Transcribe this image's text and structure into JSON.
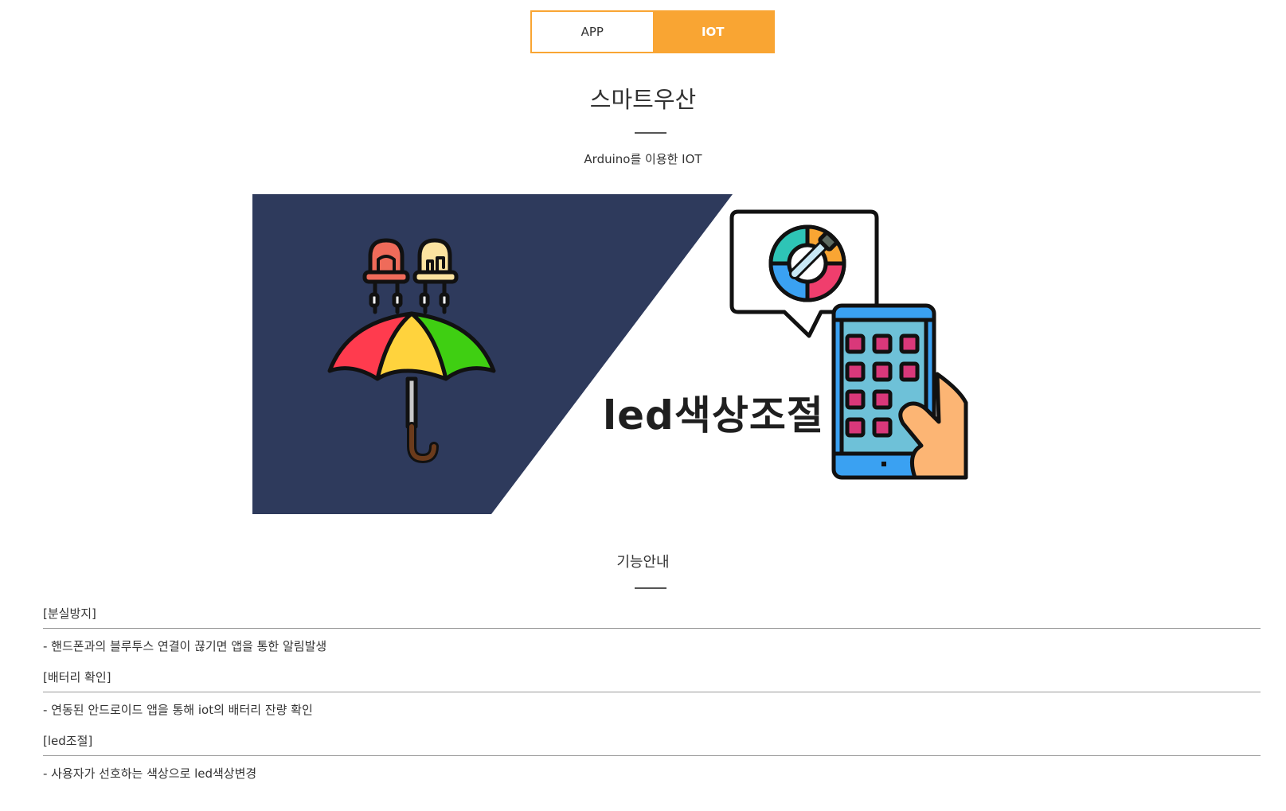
{
  "tabs": [
    {
      "label": "APP",
      "active": false
    },
    {
      "label": "IOT",
      "active": true
    }
  ],
  "colors": {
    "accent": "#f9a533",
    "hero_dark": "#2e3a5c"
  },
  "header": {
    "title": "스마트우산",
    "subtitle": "Arduino를 이용한 IOT"
  },
  "hero": {
    "caption": "led색상조절"
  },
  "section": {
    "title": "기능안내"
  },
  "features": [
    {
      "heading": "[분실방지]",
      "description": "- 핸드폰과의 블루투스 연결이 끊기면 앱을 통한 알림발생"
    },
    {
      "heading": "[배터리 확인]",
      "description": "- 연동된 안드로이드 앱을 통해 iot의 배터리 잔량 확인"
    },
    {
      "heading": "[led조절]",
      "description": "- 사용자가 선호하는 색상으로 led색상변경"
    }
  ]
}
